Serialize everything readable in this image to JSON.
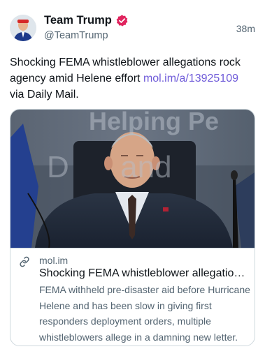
{
  "header": {
    "display_name": "Team Trump",
    "handle": "@TeamTrump",
    "timestamp": "38m",
    "verified_icon": "verified-badge-icon",
    "badge_color": "#e0245e"
  },
  "post": {
    "text": "Shocking FEMA whistleblower allegations rock agency amid Helene effort ",
    "link": "mol.im/a/13925109",
    "suffix": " via Daily Mail.",
    "link_color": "#6f5bd9"
  },
  "card": {
    "image_sign_top": "Helping Pe",
    "image_sign_bottom": "D      and",
    "domain": "mol.im",
    "title": "Shocking FEMA whistleblower allegations rock agency amid Helene effort",
    "description": "FEMA withheld pre-disaster aid before Hurricane Helene and has been slow in giving first responders deployment orders, multiple whistleblowers allege in a damning new letter.",
    "link_icon": "link-icon"
  }
}
